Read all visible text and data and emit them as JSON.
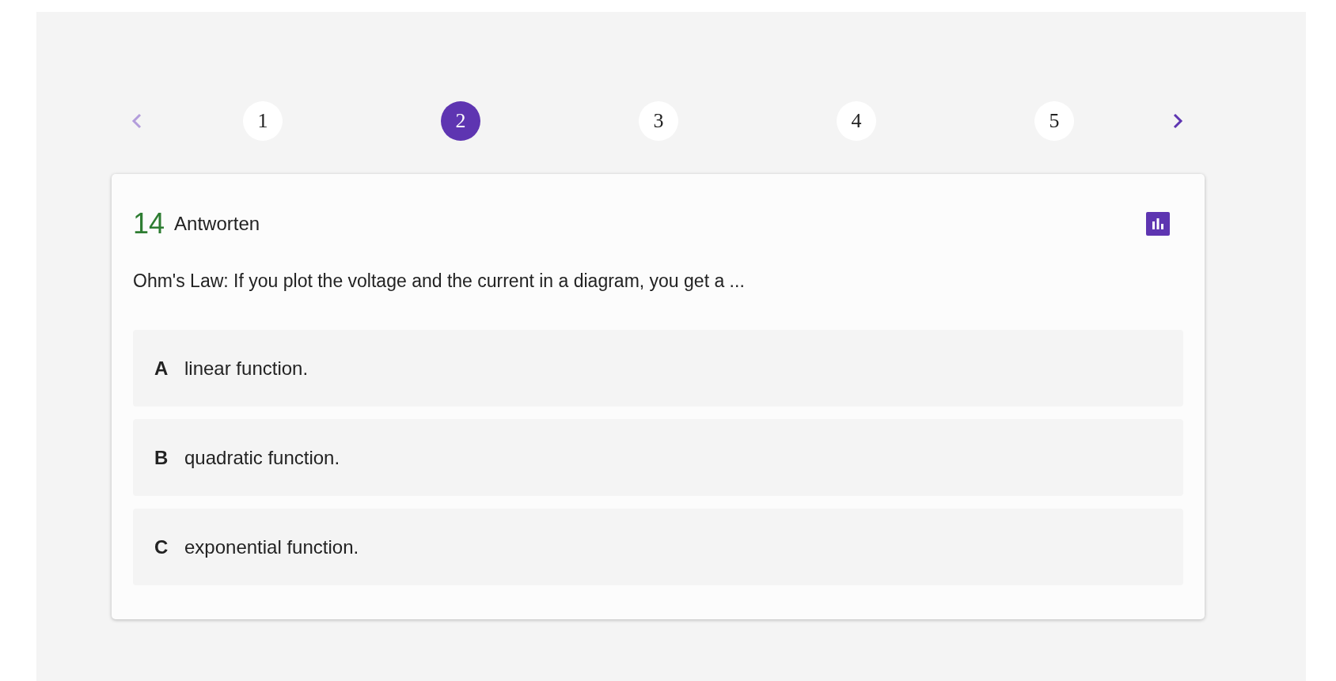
{
  "pagination": {
    "previous": {
      "disabled": true
    },
    "pages": [
      {
        "label": "1",
        "selected": false
      },
      {
        "label": "2",
        "selected": true
      },
      {
        "label": "3",
        "selected": false
      },
      {
        "label": "4",
        "selected": false
      },
      {
        "label": "5",
        "selected": false
      }
    ],
    "next": {
      "disabled": false
    }
  },
  "card": {
    "answer_count": "14",
    "answer_label": "Antworten",
    "question": "Ohm's Law: If you plot the voltage and the current in a diagram, you get a ...",
    "options": [
      {
        "letter": "A",
        "text": "linear function."
      },
      {
        "letter": "B",
        "text": "quadratic function."
      },
      {
        "letter": "C",
        "text": "exponential function."
      }
    ]
  }
}
